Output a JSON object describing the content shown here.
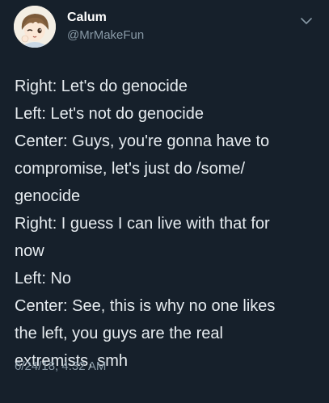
{
  "author": {
    "display_name": "Calum",
    "handle": "@MrMakeFun",
    "avatar_icon": "anime-character-avatar"
  },
  "tweet": {
    "lines": [
      "Right: Let's do genocide",
      "Left: Let's not do genocide",
      "Center: Guys, you're gonna have to",
      "compromise, let's just do /some/",
      "genocide",
      "Right: I guess I can live with that for",
      "now",
      "Left: No",
      "Center: See, this is why no one likes",
      "the left, you guys are the real",
      "extremists, smh"
    ],
    "timestamp": "6/24/18, 4:32 AM"
  },
  "menu_icon": "chevron-down-icon",
  "colors": {
    "background": "#16202b",
    "text": "#e7ecf0",
    "secondary_text": "#8899a6"
  }
}
